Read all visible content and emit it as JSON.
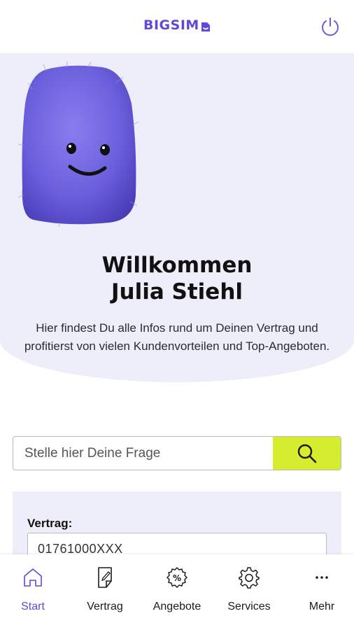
{
  "header": {
    "logo_text": "BIGSIM",
    "power_icon": "power-icon",
    "brand_color": "#5f4ad8"
  },
  "hero": {
    "title_line1": "Willkommen",
    "title_line2": "Julia Stiehl",
    "intro": "Hier findest Du alle Infos rund um Deinen Vertrag und profitierst von vielen Kundenvorteilen und Top-Angeboten.",
    "background": "#eeedfa"
  },
  "search": {
    "placeholder": "Stelle hier Deine Frage",
    "value": "",
    "button_icon": "search-icon",
    "button_color": "#d6ec2e"
  },
  "contract": {
    "label": "Vertrag:",
    "number": "01761000XXX"
  },
  "nav": {
    "items": [
      {
        "label": "Start",
        "icon": "home-icon",
        "active": true
      },
      {
        "label": "Vertrag",
        "icon": "document-edit-icon",
        "active": false
      },
      {
        "label": "Angebote",
        "icon": "percent-badge-icon",
        "active": false
      },
      {
        "label": "Services",
        "icon": "gear-icon",
        "active": false
      },
      {
        "label": "Mehr",
        "icon": "more-dots-icon",
        "active": false
      }
    ]
  }
}
